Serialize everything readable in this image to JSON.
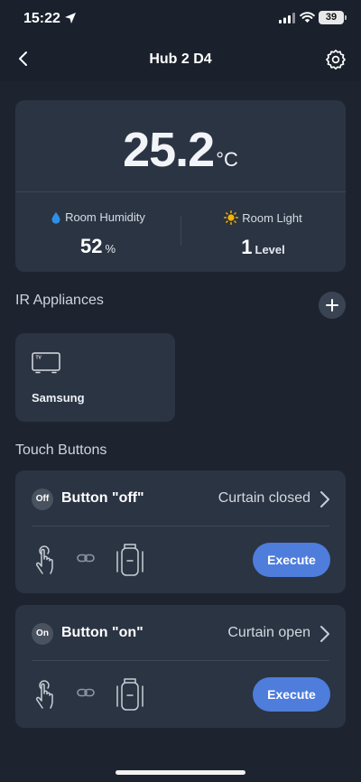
{
  "status_bar": {
    "time": "15:22",
    "battery": "39"
  },
  "nav": {
    "title": "Hub 2 D4"
  },
  "sensor": {
    "temperature_value": "25.2",
    "temperature_unit": "°C",
    "humidity_label": "Room Humidity",
    "humidity_value": "52",
    "humidity_unit": "%",
    "light_label": "Room Light",
    "light_value": "1",
    "light_unit": "Level"
  },
  "ir_section": {
    "title": "IR Appliances",
    "appliances": [
      {
        "name": "Samsung",
        "icon": "tv-icon",
        "icon_label": "TV"
      }
    ]
  },
  "touch_section": {
    "title": "Touch Buttons",
    "buttons": [
      {
        "badge": "Off",
        "name": "Button \"off\"",
        "scene": "Curtain closed",
        "action": "Execute"
      },
      {
        "badge": "On",
        "name": "Button \"on\"",
        "scene": "Curtain open",
        "action": "Execute"
      }
    ]
  },
  "colors": {
    "accent": "#4e7ddc",
    "card": "#2b3443",
    "background": "#1d2430",
    "humidity_icon": "#2f8fe6",
    "light_icon": "#f6b400"
  }
}
